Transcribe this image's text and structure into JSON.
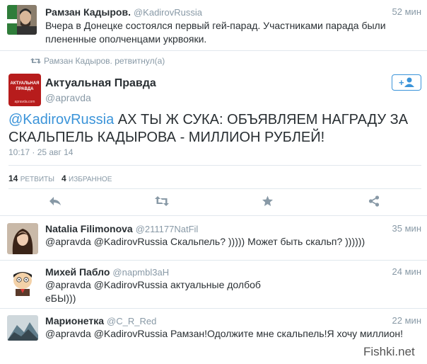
{
  "tweets": [
    {
      "name": "Рамзан Кадыров.",
      "handle": "@KadirovRussia",
      "time": "52 мин",
      "text": "Вчера в Донецке состоялся первый гей-парад. Участниками парада были плененные ополченцами укрвояки."
    }
  ],
  "retweet_notice": "Рамзан Кадыров. ретвитнул(а)",
  "main_tweet": {
    "avatar_line1": "АКТУАЛЬНАЯ",
    "avatar_line2": "ПРАВДА",
    "avatar_site": "apravda.com",
    "name": "Актуальная Правда",
    "handle": "@apravda",
    "mention": "@KadirovRussia",
    "text": " АХ ТЫ Ж СУКА: ОБЪЯВЛЯЕМ НАГРАДУ ЗА СКАЛЬПЕЛЬ КАДЫРОВА - МИЛЛИОН РУБЛЕЙ!",
    "date": "10:17 · 25 авг 14",
    "retweets_count": "14",
    "retweets_label": "РЕТВИТЫ",
    "favorites_count": "4",
    "favorites_label": "ИЗБРАННОЕ"
  },
  "replies": [
    {
      "name": "Natalia Filimonova",
      "handle": "@211177NatFil",
      "time": "35 мин",
      "text": "@apravda @KadirovRussia Скальпель? ))))) Может быть скальп? ))))))"
    },
    {
      "name": "Михей Пабло",
      "handle": "@napmbl3aH",
      "time": "24 мин",
      "text_line1": "@apravda @KadirovRussia актуальные долбоб",
      "text_line2": "еБЫ)))"
    },
    {
      "name": "Марионетка",
      "handle": "@C_R_Red",
      "time": "22 мин",
      "text": "@apravda @KadirovRussia Рамзан!Одолжите мне скальпель!Я хочу миллион! LOL"
    }
  ],
  "watermark": "Fishki.net",
  "colors": {
    "link": "#3b94d9",
    "muted": "#8899a6",
    "text": "#292f33",
    "border": "#e1e8ed"
  }
}
